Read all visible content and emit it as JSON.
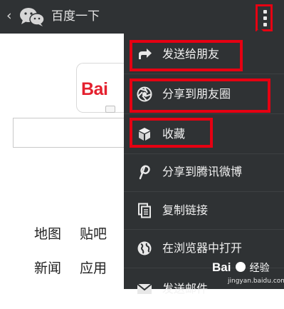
{
  "header": {
    "title": "百度一下",
    "back_icon": "chevron-left-icon",
    "app_icon": "wechat-icon",
    "more_icon": "more-vertical-icon"
  },
  "page": {
    "logo_text": "Bai",
    "links_row1": [
      "地图",
      "贴吧"
    ],
    "links_row2": [
      "新闻",
      "应用"
    ]
  },
  "menu": {
    "items": [
      {
        "label": "发送给朋友",
        "icon": "share-arrow-icon"
      },
      {
        "label": "分享到朋友圈",
        "icon": "moments-aperture-icon"
      },
      {
        "label": "收藏",
        "icon": "favorite-cube-icon"
      },
      {
        "label": "分享到腾讯微博",
        "icon": "weibo-icon"
      },
      {
        "label": "复制链接",
        "icon": "copy-link-icon"
      },
      {
        "label": "在浏览器中打开",
        "icon": "globe-icon"
      },
      {
        "label": "发送邮件",
        "icon": "mail-icon"
      }
    ]
  },
  "watermark": {
    "brand": "Bai",
    "brand_suffix": "经验",
    "url": "jingyan.baidu.com"
  },
  "colors": {
    "topbar": "#2f3234",
    "highlight": "#e60012",
    "logo_red": "#e4202e"
  }
}
